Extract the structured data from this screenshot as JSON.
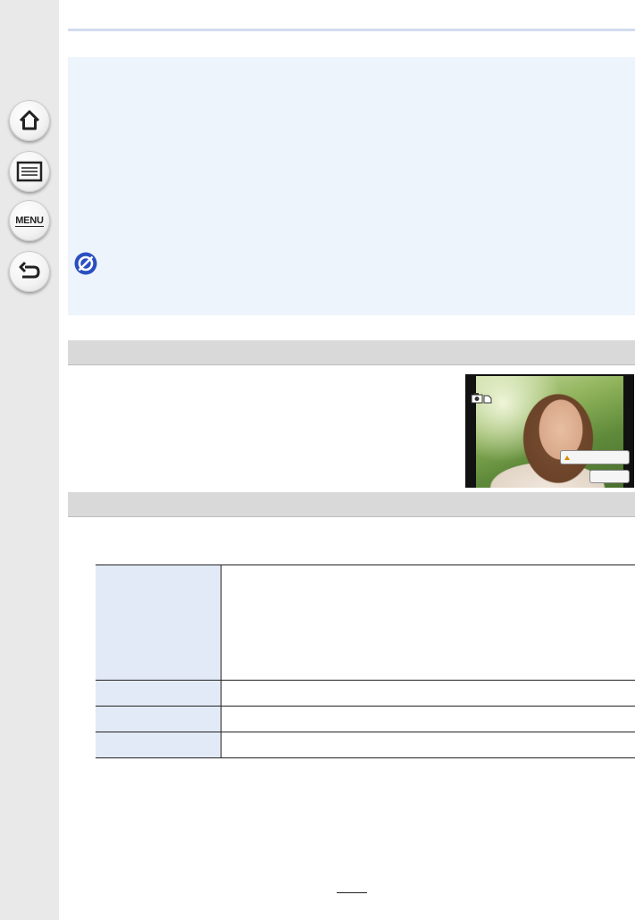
{
  "sidebar": {
    "buttons": [
      {
        "icon": "home-icon"
      },
      {
        "icon": "contents-list-icon"
      },
      {
        "icon": "menu-icon",
        "label": "MENU"
      },
      {
        "icon": "back-arrow-icon"
      }
    ]
  },
  "info_box": {
    "notice_icon": "not-available-icon",
    "text_lines": []
  },
  "sections": [
    {
      "title": ""
    },
    {
      "title": ""
    }
  ],
  "photo_preview": {
    "mode_icon": "camera-mode-icon",
    "warning_label": "",
    "button_label": ""
  },
  "settings_table": {
    "rows": [
      {
        "key": "",
        "value": ""
      },
      {
        "key": "",
        "value": ""
      },
      {
        "key": "",
        "value": ""
      },
      {
        "key": "",
        "value": ""
      }
    ]
  },
  "colors": {
    "sidebar_bg": "#e9e9e9",
    "info_box_bg": "#eef4fc",
    "section_bar_bg": "#d9d9d9",
    "table_key_bg": "#e3eaf7",
    "notice_blue": "#2a4fc0"
  },
  "page_number": ""
}
